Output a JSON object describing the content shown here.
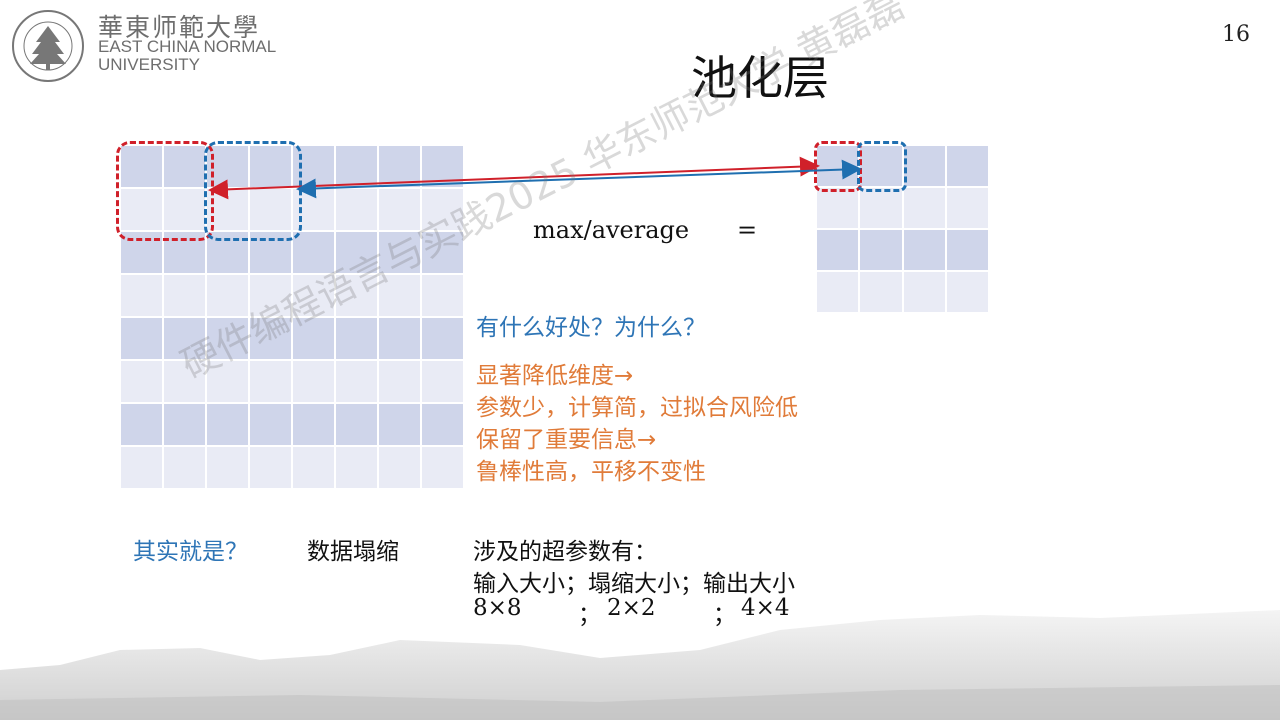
{
  "header": {
    "logo_cn": "華東师範大學",
    "logo_en_line1": "EAST CHINA NORMAL",
    "logo_en_line2": "UNIVERSITY",
    "slide_number": "16"
  },
  "title": "池化层",
  "formula": "max/average",
  "equals": "=",
  "question": "有什么好处？为什么？",
  "benefits": [
    "显著降低维度→",
    "参数少，计算简，过拟合风险低",
    "保留了重要信息→",
    "鲁棒性高，平移不变性"
  ],
  "bottom": {
    "q": "其实就是？",
    "answer": "数据塌缩",
    "hyper_title": "涉及的超参数有：",
    "hyper_row1": "输入大小；塌缩大小；输出大小",
    "hyper_row2_a": "8×8",
    "hyper_row2_sep1": "；",
    "hyper_row2_b": "2×2",
    "hyper_row2_sep2": "；",
    "hyper_row2_c": "4×4"
  },
  "watermark": "硬件编程语言与实践2025 华东师范大学 黄磊磊",
  "colors": {
    "red": "#d0202a",
    "blue": "#2e75b6",
    "orange": "#e07b39",
    "grid_dark": "#cfd5ea",
    "grid_light": "#e9ebf5"
  }
}
